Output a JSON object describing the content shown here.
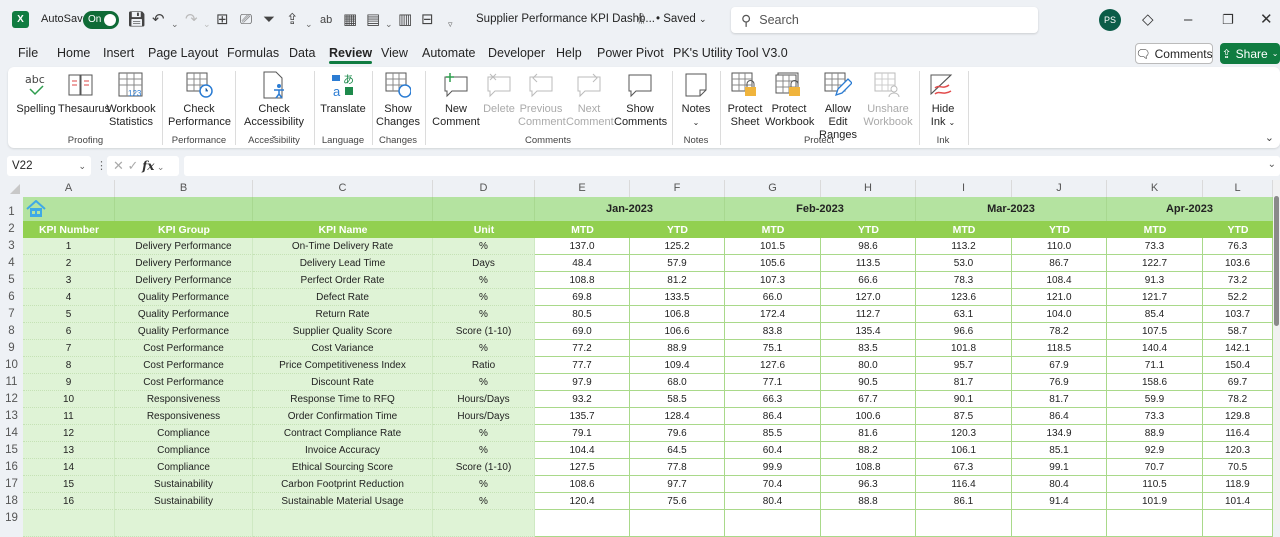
{
  "titlebar": {
    "autosave_label": "AutoSave",
    "autosave_state": "On",
    "doc_title": "Supplier Performance KPI Dashb...",
    "saved_status": "• Saved",
    "search_placeholder": "Search",
    "user_initials": "PS",
    "avatar_color": "#0b5c48"
  },
  "menu": {
    "tabs": [
      "File",
      "Home",
      "Insert",
      "Page Layout",
      "Formulas",
      "Data",
      "Review",
      "View",
      "Automate",
      "Developer",
      "Help",
      "Power Pivot",
      "PK's Utility Tool V3.0"
    ],
    "active_tab": "Review",
    "comments_label": "Comments",
    "share_label": "Share",
    "accent_color": "#107c41"
  },
  "ribbon": {
    "buttons": {
      "spelling": "Spelling",
      "thesaurus": "Thesaurus",
      "workbook_statistics": "Workbook Statistics",
      "check_performance": "Check Performance",
      "check_accessibility": "Check Accessibility",
      "translate": "Translate",
      "show_changes": "Show Changes",
      "new_comment": "New Comment",
      "delete": "Delete",
      "previous_comment": "Previous Comment",
      "next_comment": "Next Comment",
      "show_comments": "Show Comments",
      "notes": "Notes",
      "protect_sheet": "Protect Sheet",
      "protect_workbook": "Protect Workbook",
      "allow_edit_ranges": "Allow Edit Ranges",
      "unshare_workbook": "Unshare Workbook",
      "hide_ink": "Hide Ink"
    },
    "groups": {
      "proofing": "Proofing",
      "performance": "Performance",
      "accessibility": "Accessibility",
      "language": "Language",
      "changes": "Changes",
      "comments": "Comments",
      "notes": "Notes",
      "protect": "Protect",
      "ink": "Ink"
    }
  },
  "formula_bar": {
    "name_box": "V22",
    "formula": ""
  },
  "sheet": {
    "columns": [
      "A",
      "B",
      "C",
      "D",
      "E",
      "F",
      "G",
      "H",
      "I",
      "J",
      "K",
      "L"
    ],
    "row_numbers": [
      "1",
      "2",
      "3",
      "4",
      "5",
      "6",
      "7",
      "8",
      "9",
      "10",
      "11",
      "12",
      "13",
      "14",
      "15",
      "16",
      "17",
      "18",
      "19"
    ],
    "headers": {
      "kpi_number": "KPI Number",
      "kpi_group": "KPI Group",
      "kpi_name": "KPI Name",
      "unit": "Unit"
    },
    "months": [
      "Jan-2023",
      "Feb-2023",
      "Mar-2023",
      "Apr-2023"
    ],
    "sub_headers": [
      "MTD",
      "YTD"
    ],
    "header_colors": {
      "row1": "#b4e3a0",
      "row2": "#92d050",
      "body": "#dff3d6"
    },
    "rows": [
      {
        "num": "1",
        "group": "Delivery Performance",
        "name": "On-Time Delivery Rate",
        "unit": "%",
        "values": [
          "137.0",
          "125.2",
          "101.5",
          "98.6",
          "113.2",
          "110.0",
          "73.3",
          "76.3"
        ]
      },
      {
        "num": "2",
        "group": "Delivery Performance",
        "name": "Delivery Lead Time",
        "unit": "Days",
        "values": [
          "48.4",
          "57.9",
          "105.6",
          "113.5",
          "53.0",
          "86.7",
          "122.7",
          "103.6"
        ]
      },
      {
        "num": "3",
        "group": "Delivery Performance",
        "name": "Perfect Order Rate",
        "unit": "%",
        "values": [
          "108.8",
          "81.2",
          "107.3",
          "66.6",
          "78.3",
          "108.4",
          "91.3",
          "73.2"
        ]
      },
      {
        "num": "4",
        "group": "Quality Performance",
        "name": "Defect Rate",
        "unit": "%",
        "values": [
          "69.8",
          "133.5",
          "66.0",
          "127.0",
          "123.6",
          "121.0",
          "121.7",
          "52.2"
        ]
      },
      {
        "num": "5",
        "group": "Quality Performance",
        "name": "Return Rate",
        "unit": "%",
        "values": [
          "80.5",
          "106.8",
          "172.4",
          "112.7",
          "63.1",
          "104.0",
          "85.4",
          "103.7"
        ]
      },
      {
        "num": "6",
        "group": "Quality Performance",
        "name": "Supplier Quality Score",
        "unit": "Score (1-10)",
        "values": [
          "69.0",
          "106.6",
          "83.8",
          "135.4",
          "96.6",
          "78.2",
          "107.5",
          "58.7"
        ]
      },
      {
        "num": "7",
        "group": "Cost Performance",
        "name": "Cost Variance",
        "unit": "%",
        "values": [
          "77.2",
          "88.9",
          "75.1",
          "83.5",
          "101.8",
          "118.5",
          "140.4",
          "142.1"
        ]
      },
      {
        "num": "8",
        "group": "Cost Performance",
        "name": "Price Competitiveness Index",
        "unit": "Ratio",
        "values": [
          "77.7",
          "109.4",
          "127.6",
          "80.0",
          "95.7",
          "67.9",
          "71.1",
          "150.4"
        ]
      },
      {
        "num": "9",
        "group": "Cost Performance",
        "name": "Discount Rate",
        "unit": "%",
        "values": [
          "97.9",
          "68.0",
          "77.1",
          "90.5",
          "81.7",
          "76.9",
          "158.6",
          "69.7"
        ]
      },
      {
        "num": "10",
        "group": "Responsiveness",
        "name": "Response Time to RFQ",
        "unit": "Hours/Days",
        "values": [
          "93.2",
          "58.5",
          "66.3",
          "67.7",
          "90.1",
          "81.7",
          "59.9",
          "78.2"
        ]
      },
      {
        "num": "11",
        "group": "Responsiveness",
        "name": "Order Confirmation Time",
        "unit": "Hours/Days",
        "values": [
          "135.7",
          "128.4",
          "86.4",
          "100.6",
          "87.5",
          "86.4",
          "73.3",
          "129.8"
        ]
      },
      {
        "num": "12",
        "group": "Compliance",
        "name": "Contract Compliance Rate",
        "unit": "%",
        "values": [
          "79.1",
          "79.6",
          "85.5",
          "81.6",
          "120.3",
          "134.9",
          "88.9",
          "116.4"
        ]
      },
      {
        "num": "13",
        "group": "Compliance",
        "name": "Invoice Accuracy",
        "unit": "%",
        "values": [
          "104.4",
          "64.5",
          "60.4",
          "88.2",
          "106.1",
          "85.1",
          "92.9",
          "120.3"
        ]
      },
      {
        "num": "14",
        "group": "Compliance",
        "name": "Ethical Sourcing Score",
        "unit": "Score (1-10)",
        "values": [
          "127.5",
          "77.8",
          "99.9",
          "108.8",
          "67.3",
          "99.1",
          "70.7",
          "70.5"
        ]
      },
      {
        "num": "15",
        "group": "Sustainability",
        "name": "Carbon Footprint Reduction",
        "unit": "%",
        "values": [
          "108.6",
          "97.7",
          "70.4",
          "96.3",
          "116.4",
          "80.4",
          "110.5",
          "118.9"
        ]
      },
      {
        "num": "16",
        "group": "Sustainability",
        "name": "Sustainable Material Usage",
        "unit": "%",
        "values": [
          "120.4",
          "75.6",
          "80.4",
          "88.8",
          "86.1",
          "91.4",
          "101.9",
          "101.4"
        ]
      }
    ]
  }
}
